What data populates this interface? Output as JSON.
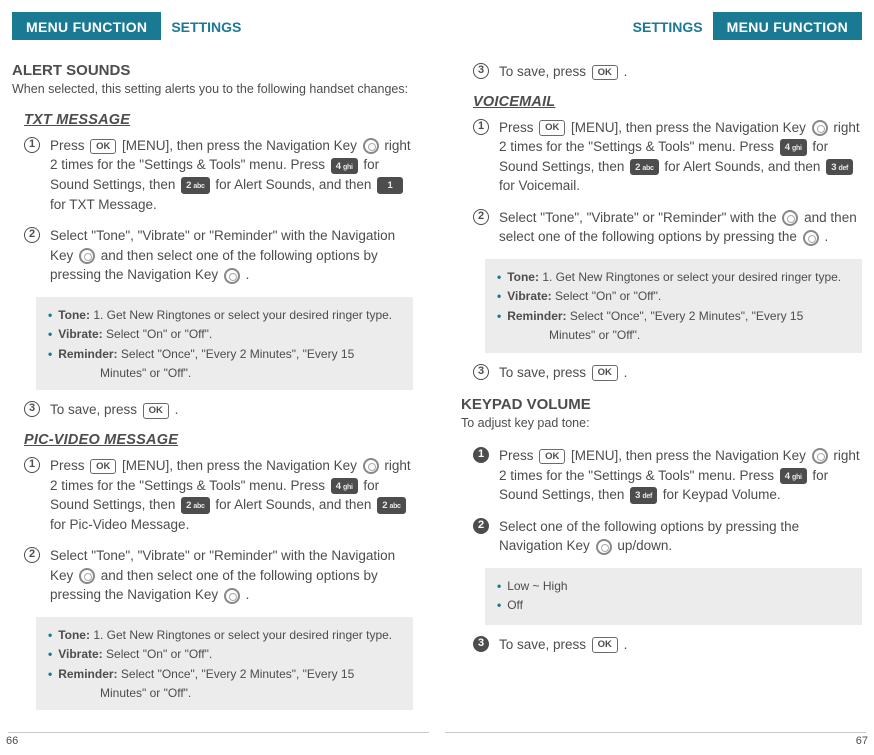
{
  "header": {
    "menu_function": "MENU FUNCTION",
    "settings": "SETTINGS"
  },
  "left": {
    "alert_sounds": {
      "title": "ALERT SOUNDS",
      "desc": "When selected, this setting alerts you to the following handset changes:"
    },
    "txt_message": {
      "heading": "TXT MESSAGE",
      "step1_a": "Press ",
      "step1_b": " [MENU], then press the Navigation Key ",
      "step1_c": " right 2 times for the \"Settings & Tools\" menu. Press ",
      "step1_d": " for Sound Settings, then ",
      "step1_e": " for Alert Sounds, and then ",
      "step1_f": " for TXT Message.",
      "step2_a": "Select \"Tone\", \"Vibrate\" or \"Reminder\" with the Navigation Key ",
      "step2_b": " and then select one of the following options by pressing the Navigation Key ",
      "step2_c": " .",
      "callout": {
        "tone_label": "Tone:",
        "tone_text": "1. Get New Ringtones or select your desired ringer type.",
        "vibrate_label": "Vibrate:",
        "vibrate_text": "Select \"On\" or \"Off\".",
        "reminder_label": "Reminder:",
        "reminder_text1": "Select \"Once\", \"Every 2 Minutes\", \"Every 15",
        "reminder_text2": "Minutes\" or \"Off\"."
      },
      "step3_a": "To save, press ",
      "step3_b": " ."
    },
    "pic_video": {
      "heading": "PIC-VIDEO MESSAGE",
      "step1_a": "Press ",
      "step1_b": " [MENU], then press the Navigation Key ",
      "step1_c": " right 2 times for the \"Settings & Tools\" menu. Press ",
      "step1_d": " for Sound Settings, then ",
      "step1_e": " for Alert Sounds, and then ",
      "step1_f": " for Pic-Video Message.",
      "step2_a": "Select \"Tone\", \"Vibrate\" or \"Reminder\" with the Navigation Key ",
      "step2_b": " and then select one of the following options by pressing the Navigation Key ",
      "step2_c": " .",
      "callout": {
        "tone_label": "Tone:",
        "tone_text": "1. Get New Ringtones or select your desired ringer type.",
        "vibrate_label": "Vibrate:",
        "vibrate_text": "Select \"On\" or \"Off\".",
        "reminder_label": "Reminder:",
        "reminder_text1": "Select \"Once\", \"Every 2 Minutes\", \"Every 15",
        "reminder_text2": "Minutes\" or \"Off\"."
      }
    },
    "pagenum": "66"
  },
  "right": {
    "top_save_a": "To save, press ",
    "top_save_b": " .",
    "voicemail": {
      "heading": "VOICEMAIL",
      "step1_a": "Press ",
      "step1_b": " [MENU], then press the Navigation Key ",
      "step1_c": " right 2 times for the \"Settings & Tools\" menu. Press ",
      "step1_d": " for Sound Settings, then ",
      "step1_e": " for Alert Sounds, and then ",
      "step1_f": " for Voicemail.",
      "step2_a": "Select \"Tone\", \"Vibrate\" or \"Reminder\" with the ",
      "step2_b": " and then select one of the following options by pressing the ",
      "step2_c": " .",
      "callout": {
        "tone_label": "Tone:",
        "tone_text": "1. Get New Ringtones or select your desired ringer type.",
        "vibrate_label": "Vibrate:",
        "vibrate_text": "Select \"On\" or \"Off\".",
        "reminder_label": "Reminder:",
        "reminder_text1": "Select \"Once\", \"Every 2 Minutes\", \"Every 15",
        "reminder_text2": "Minutes\" or \"Off\"."
      },
      "step3_a": "To save, press ",
      "step3_b": " ."
    },
    "keypad": {
      "title": "KEYPAD VOLUME",
      "desc": "To adjust key pad tone:",
      "step1_a": "Press ",
      "step1_b": " [MENU], then press the Navigation Key ",
      "step1_c": " right 2 times for the \"Settings & Tools\" menu. Press ",
      "step1_d": " for Sound Settings, then ",
      "step1_e": " for Keypad Volume.",
      "step2": "Select one of the following options by pressing the Navigation Key ",
      "step2_b": " up/down.",
      "callout": {
        "opt1": "Low ~ High",
        "opt2": "Off"
      },
      "step3_a": "To save, press ",
      "step3_b": " ."
    },
    "pagenum": "67"
  },
  "keys": {
    "ok": "OK",
    "k1": "1",
    "k1s": "",
    "k2": "2",
    "k2s": "abc",
    "k3": "3",
    "k3s": "def",
    "k4": "4",
    "k4s": "ghi"
  }
}
